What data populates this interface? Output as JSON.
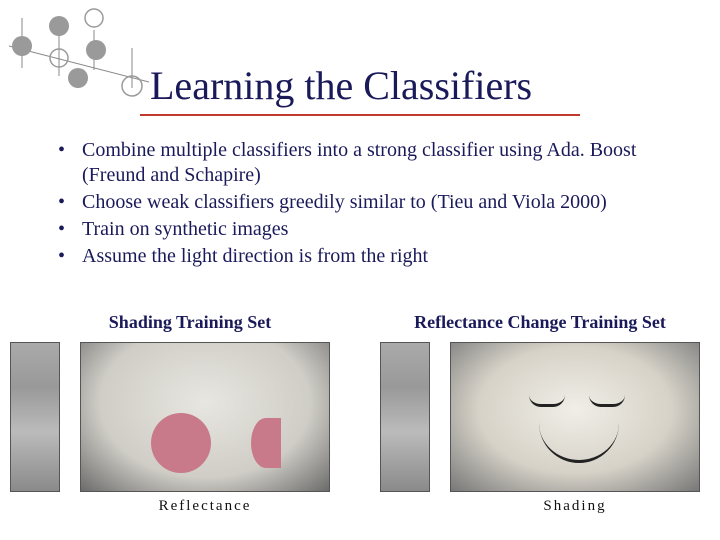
{
  "title": "Learning the Classifiers",
  "bullets": [
    "Combine multiple classifiers into a strong classifier using Ada. Boost (Freund and Schapire)",
    "Choose weak classifiers greedily similar to (Tieu and Viola 2000)",
    "Train on synthetic images",
    "Assume the light direction is from the right"
  ],
  "captions": {
    "left": "Shading Training Set",
    "right": "Reflectance Change Training Set"
  },
  "image_labels": {
    "reflect": "Reflectance",
    "shading": "Shading"
  }
}
